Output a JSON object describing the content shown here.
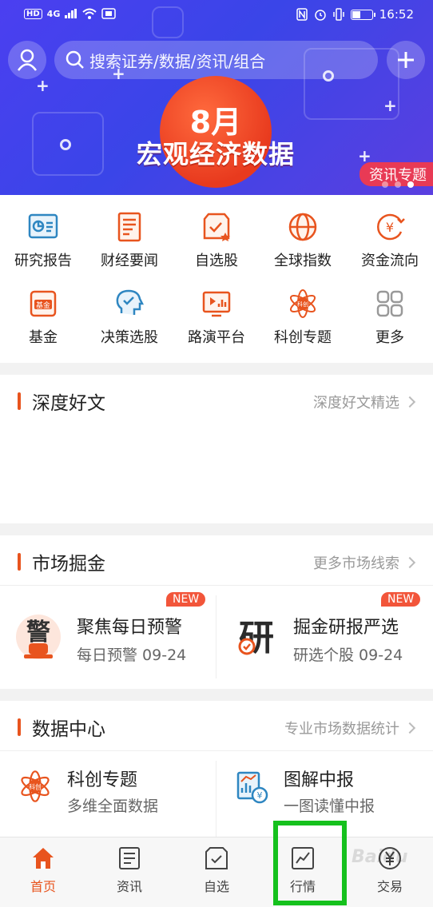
{
  "status_bar": {
    "left_badges": [
      "HD",
      "4G"
    ],
    "time": "16:52"
  },
  "search": {
    "placeholder": "搜索证券/数据/资讯/组合"
  },
  "banner": {
    "month": "8月",
    "title": "宏观经济数据",
    "tag": "资讯专题",
    "pager_count": 3,
    "pager_active": 3
  },
  "quick_grid": [
    {
      "label": "研究报告",
      "icon": "research-report-icon"
    },
    {
      "label": "财经要闻",
      "icon": "news-icon"
    },
    {
      "label": "自选股",
      "icon": "watchlist-icon"
    },
    {
      "label": "全球指数",
      "icon": "globe-icon"
    },
    {
      "label": "资金流向",
      "icon": "money-flow-icon"
    },
    {
      "label": "基金",
      "icon": "fund-icon"
    },
    {
      "label": "决策选股",
      "icon": "decision-icon"
    },
    {
      "label": "路演平台",
      "icon": "roadshow-icon"
    },
    {
      "label": "科创专题",
      "icon": "star-board-icon"
    },
    {
      "label": "更多",
      "icon": "more-grid-icon"
    }
  ],
  "sections": {
    "deep": {
      "title": "深度好文",
      "more": "深度好文精选"
    },
    "market": {
      "title": "市场掘金",
      "more": "更多市场线索",
      "cards": [
        {
          "title": "聚焦每日预警",
          "sub": "每日预警 09-24",
          "badge": "NEW",
          "icon_text": "警"
        },
        {
          "title": "掘金研报严选",
          "sub": "研选个股 09-24",
          "badge": "NEW",
          "icon_text": "研"
        }
      ]
    },
    "data": {
      "title": "数据中心",
      "more": "专业市场数据统计",
      "cards": [
        {
          "title": "科创专题",
          "sub": "多维全面数据",
          "icon_text": "科创"
        },
        {
          "title": "图解中报",
          "sub": "一图读懂中报",
          "icon_text": "¥"
        }
      ]
    }
  },
  "bottom_nav": [
    {
      "label": "首页",
      "icon": "home-icon",
      "active": true
    },
    {
      "label": "资讯",
      "icon": "news-list-icon",
      "active": false
    },
    {
      "label": "自选",
      "icon": "watchlist-icon",
      "active": false
    },
    {
      "label": "行情",
      "icon": "market-chart-icon",
      "active": false
    },
    {
      "label": "交易",
      "icon": "yuan-icon",
      "active": false
    }
  ],
  "watermark": "Baidu",
  "colors": {
    "accent": "#e8541e",
    "banner": "#4b3ff0",
    "highlight": "#15c11d"
  }
}
